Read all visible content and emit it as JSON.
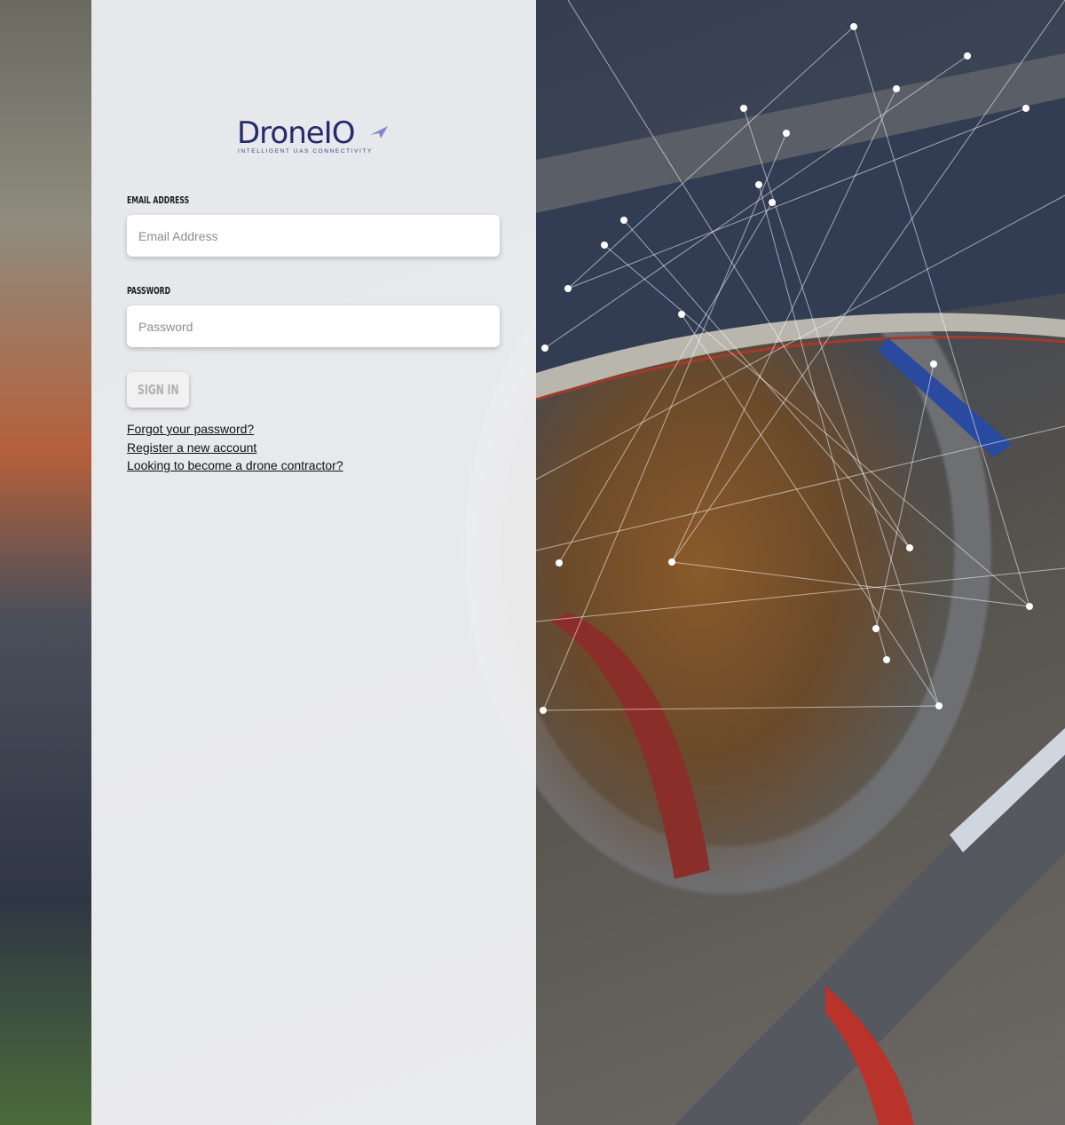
{
  "brand": {
    "name": "DroneIO",
    "tagline": "INTELLIGENT UAS CONNECTIVITY"
  },
  "form": {
    "email_label": "EMAIL ADDRESS",
    "email_placeholder": "Email Address",
    "password_label": "PASSWORD",
    "password_placeholder": "Password",
    "signin_label": "SIGN IN"
  },
  "links": {
    "forgot": "Forgot your password?",
    "register": "Register a new account",
    "contractor": "Looking to become a drone contractor?"
  }
}
